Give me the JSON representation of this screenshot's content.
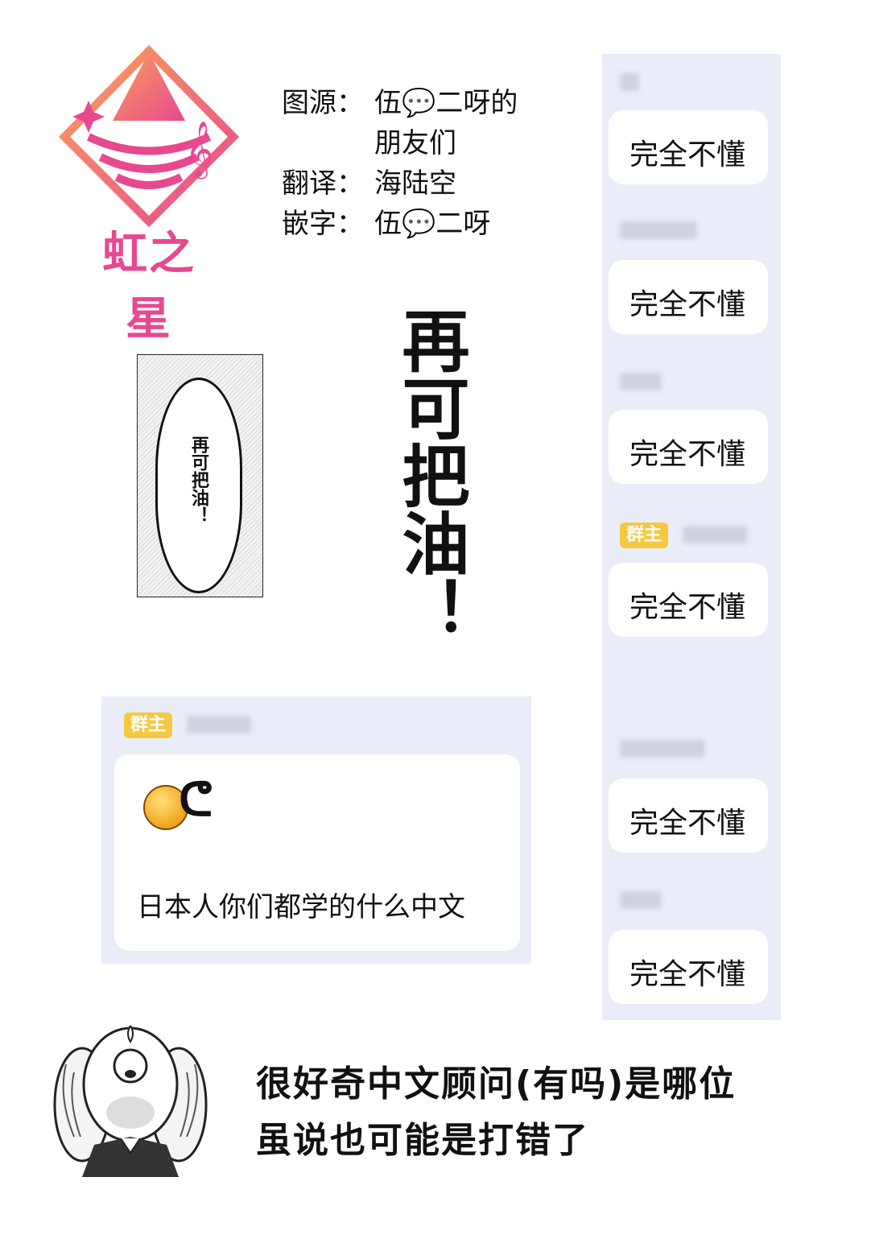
{
  "logo": {
    "text": "虹之星",
    "colors": {
      "primary": "#e8488f",
      "secondary": "#f58a3c"
    },
    "icon": "star-music-icon"
  },
  "credits": [
    {
      "label": "图源：",
      "value": "伍💬二呀的"
    },
    {
      "label": "",
      "value": "朋友们"
    },
    {
      "label": "翻译：",
      "value": "海陆空"
    },
    {
      "label": "嵌字：",
      "value": "伍💬二呀"
    }
  ],
  "panel": {
    "speech": "再可把油！"
  },
  "big_text": "再可把油！",
  "chat_left": {
    "badge": "群主",
    "message": "日本人你们都学的什么中文",
    "emoji": "smiling-face-icon"
  },
  "chat_right": {
    "messages": [
      {
        "text": "完全不懂"
      },
      {
        "text": "完全不懂"
      },
      {
        "text": "完全不懂"
      },
      {
        "text": "完全不懂",
        "badge": "群主"
      },
      {
        "text": "完全不懂"
      },
      {
        "text": "完全不懂"
      }
    ]
  },
  "note": {
    "line1": "很好奇中文顾问(有吗)是哪位",
    "line2": "虽说也可能是打错了"
  },
  "colors": {
    "chat_bg": "#eaedf8",
    "badge": "#f6c841"
  }
}
